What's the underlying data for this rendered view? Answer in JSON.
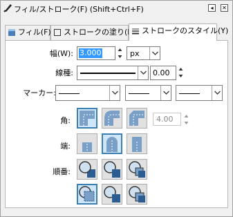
{
  "window": {
    "title": "フィル/ストローク(F) (Shift+Ctrl+F)",
    "buttons": [
      "◂",
      "✕"
    ]
  },
  "tabs": [
    {
      "label": "フィル(F)",
      "icon": "fill-icon"
    },
    {
      "label": "ストロークの塗り(P)",
      "icon": "stroke-paint-icon"
    },
    {
      "label": "ストロークのスタイル(Y)",
      "icon": "stroke-style-icon"
    }
  ],
  "width": {
    "label": "幅(W):",
    "value": "3.000",
    "unit": "px"
  },
  "dash": {
    "label": "線種:",
    "offset": "0.00"
  },
  "markers": {
    "label": "マーカー:"
  },
  "join": {
    "label": "角:",
    "miter_limit": "4.00"
  },
  "cap": {
    "label": "端:"
  },
  "order": {
    "label": "順番:"
  },
  "colors": {
    "accent": "#3c7fb1",
    "shape": "#7aa0c8",
    "dark_shape": "#2b5c92"
  }
}
